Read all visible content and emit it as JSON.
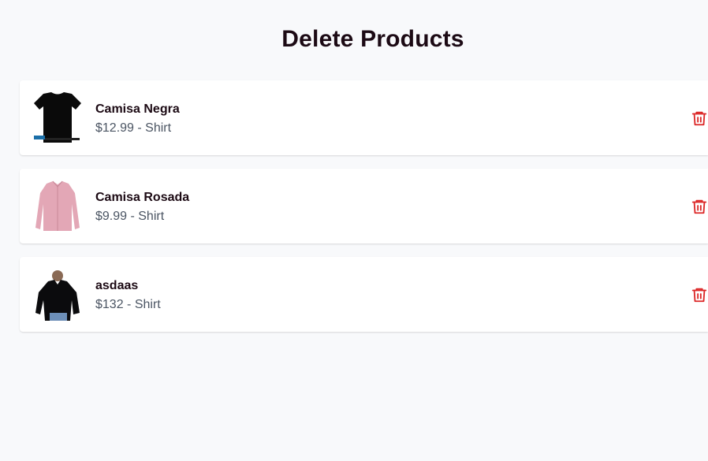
{
  "page": {
    "title": "Delete Products"
  },
  "products": [
    {
      "name": "Camisa Negra",
      "price": "$12.99",
      "category": "Shirt",
      "meta": "$12.99 - Shirt",
      "image": "black-tshirt"
    },
    {
      "name": "Camisa Rosada",
      "price": "$9.99",
      "category": "Shirt",
      "meta": "$9.99 - Shirt",
      "image": "pink-dress-shirt"
    },
    {
      "name": "asdaas",
      "price": "$132",
      "category": "Shirt",
      "meta": "$132 - Shirt",
      "image": "black-blouse"
    }
  ],
  "icons": {
    "delete": "trash-icon"
  },
  "colors": {
    "background": "#f8f9fb",
    "card": "#ffffff",
    "title": "#1c0a14",
    "meta": "#4b5563",
    "delete": "#dc2626"
  }
}
